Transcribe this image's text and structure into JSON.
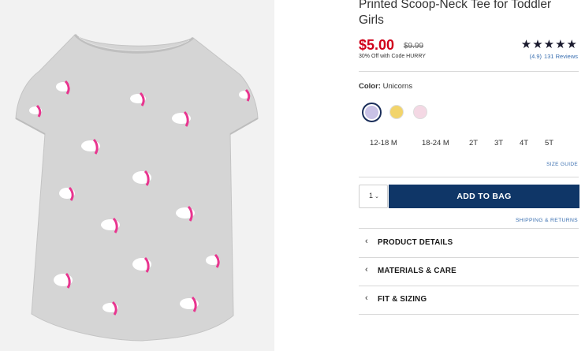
{
  "product": {
    "title": "Printed Scoop-Neck Tee for Toddler Girls",
    "price": "$5.00",
    "original_price": "$9.99",
    "promo": "30% Off with Code HURRY",
    "rating_stars": "★★★★★",
    "rating": "(4.9)",
    "reviews": "131 Reviews"
  },
  "color": {
    "label": "Color:",
    "value": "Unicorns",
    "swatches": [
      {
        "name": "Unicorns",
        "color": "#c9c2e6"
      },
      {
        "name": "yellow-print",
        "color": "#f2d46b"
      },
      {
        "name": "pink-print",
        "color": "#f4d8e4"
      }
    ]
  },
  "sizes": [
    "12-18 M",
    "18-24 M",
    "2T",
    "3T",
    "4T",
    "5T"
  ],
  "size_guide": "SIZE GUIDE",
  "cart": {
    "quantity": "1",
    "add_to_bag": "ADD TO BAG",
    "shipping_returns": "SHIPPING & RETURNS"
  },
  "accordions": [
    "PRODUCT DETAILS",
    "MATERIALS & CARE",
    "FIT & SIZING"
  ],
  "colors": {
    "price_red": "#d0021b",
    "navy_button": "#0f3667",
    "link_blue": "#3a6fb0",
    "shirt_gray": "#d6d6d6",
    "unicorn_pink": "#e8358f"
  }
}
